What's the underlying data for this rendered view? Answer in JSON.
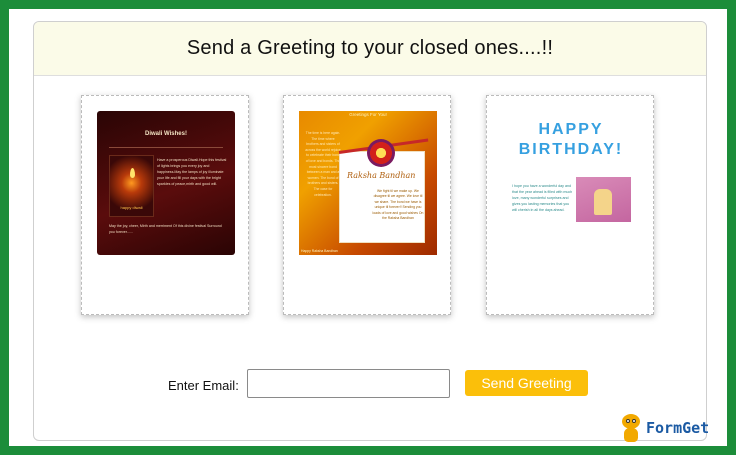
{
  "header": {
    "title": "Send a Greeting to your closed ones....!!"
  },
  "cards": {
    "diwali": {
      "title": "Diwali Wishes!",
      "message": "Have a prosperous Diwali.Hope this festival of lights brings you every joy and happiness.May the lamps of joy illuminate your life and fill your days with the bright sparkles of peace,mirth and good will.",
      "image_caption": "happy diwali",
      "footer": "May the joy, cheer, Mirth and merriment Of this divine festival Surround you forever......"
    },
    "raksha": {
      "header": "Greetings For You!",
      "left_text": "The time is here again. The time where brothers and sisters of across the world rejoice to celebrate their bond of love and bonds. The most sincere bond between a man and a women. The bond of brothers and sisters. The case for celebration.",
      "title": "Raksha Bandhan",
      "message": "We fight til we make up. We disagree til we agree. We love til we share. The bond we have is unique til forever!! Sending you loads of love and good wishes On the Raksha Bandhan",
      "footer": "Happy Raksha Bandhan"
    },
    "birthday": {
      "title_line1": "HAPPY",
      "title_line2": "BIRTHDAY!",
      "message": "I hope you have a wonderful day and that the year ahead is filled with much love, many wonderful surprises and gives you lasting memories that you will cherish in all the days ahead."
    }
  },
  "form": {
    "email_label": "Enter Email:",
    "email_value": "",
    "send_label": "Send Greeting"
  },
  "logo": {
    "text": "FormGet"
  },
  "colors": {
    "border_green": "#1c8d3a",
    "header_bg": "#fbfbe8",
    "button": "#fbbf0a",
    "logo_text": "#1b5aa3"
  }
}
